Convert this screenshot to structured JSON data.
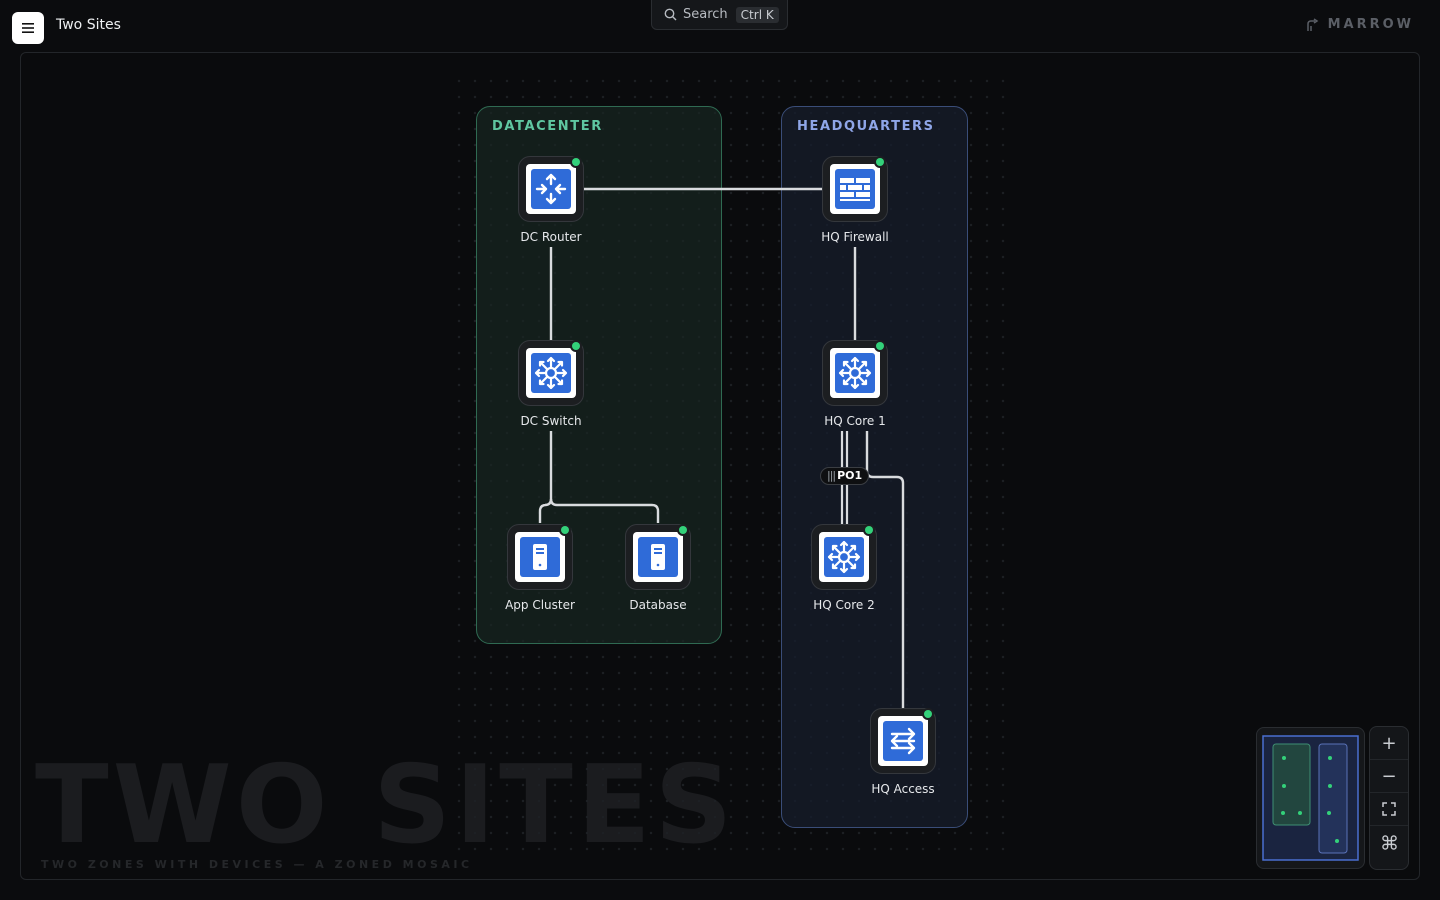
{
  "header": {
    "title": "Two Sites",
    "search": {
      "label": "Search",
      "shortcut": "Ctrl K"
    },
    "brand": "MARROW"
  },
  "canvas": {
    "watermark_title": "TWO SITES",
    "watermark_subtitle": "TWO ZONES WITH DEVICES — A ZONED MOSAIC"
  },
  "zones": {
    "datacenter": {
      "label": "DATACENTER",
      "color": "#5fc7a1"
    },
    "headquarters": {
      "label": "HEADQUARTERS",
      "color": "#8fa6e8"
    }
  },
  "nodes": {
    "dc_router": {
      "label": "DC Router",
      "icon": "router-icon",
      "status": "online"
    },
    "dc_switch": {
      "label": "DC Switch",
      "icon": "switch-icon",
      "status": "online"
    },
    "app_cluster": {
      "label": "App Cluster",
      "icon": "server-icon",
      "status": "online"
    },
    "database": {
      "label": "Database",
      "icon": "server-icon",
      "status": "online"
    },
    "hq_firewall": {
      "label": "HQ Firewall",
      "icon": "firewall-icon",
      "status": "online"
    },
    "hq_core_1": {
      "label": "HQ Core 1",
      "icon": "switch-icon",
      "status": "online"
    },
    "hq_core_2": {
      "label": "HQ Core 2",
      "icon": "switch-icon",
      "status": "online"
    },
    "hq_access": {
      "label": "HQ Access",
      "icon": "access-switch-icon",
      "status": "online"
    }
  },
  "links": [
    {
      "from": "DC Router",
      "to": "HQ Firewall"
    },
    {
      "from": "DC Router",
      "to": "DC Switch"
    },
    {
      "from": "DC Switch",
      "to": "App Cluster"
    },
    {
      "from": "DC Switch",
      "to": "Database"
    },
    {
      "from": "HQ Firewall",
      "to": "HQ Core 1"
    },
    {
      "from": "HQ Core 1",
      "to": "HQ Core 2",
      "label": "PO1"
    },
    {
      "from": "HQ Core 1",
      "to": "HQ Access"
    }
  ],
  "colors": {
    "accent_blue": "#2f6bd8",
    "status_online": "#33d17a"
  },
  "zoom_controls": {
    "zoom_in": "+",
    "zoom_out": "−",
    "fit": "fit-icon",
    "shortcuts": "command-icon"
  }
}
